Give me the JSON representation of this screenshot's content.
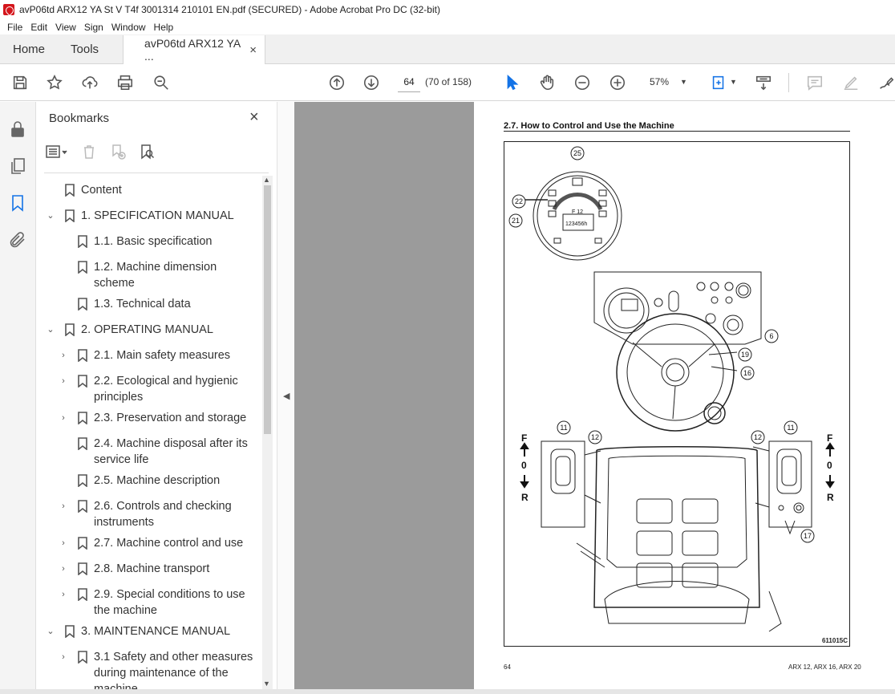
{
  "window": {
    "title": "avP06td ARX12 YA St V T4f 3001314 210101 EN.pdf (SECURED) - Adobe Acrobat Pro DC (32-bit)"
  },
  "menu": [
    "File",
    "Edit",
    "View",
    "Sign",
    "Window",
    "Help"
  ],
  "tabs": {
    "home": "Home",
    "tools": "Tools",
    "document": "avP06td ARX12 YA ...",
    "close": "×"
  },
  "toolbar": {
    "page_number": "64",
    "page_of": "(70 of 158)",
    "zoom": "57%",
    "icons": [
      "save-icon",
      "star-icon",
      "upload-icon",
      "print-icon",
      "zoom-search-icon",
      "page-up-icon",
      "page-down-icon",
      "select-cursor-icon",
      "hand-icon",
      "zoom-out-icon",
      "zoom-in-icon",
      "fit-page-icon",
      "scroll-mode-icon",
      "comment-icon",
      "highlight-icon",
      "sign-icon"
    ]
  },
  "bookmarks": {
    "title": "Bookmarks",
    "close": "×",
    "items": [
      {
        "label": "Content",
        "level": 0,
        "chevron": ""
      },
      {
        "label": "1. SPECIFICATION MANUAL",
        "level": 0,
        "chevron": "⌄"
      },
      {
        "label": "1.1. Basic specification",
        "level": 1,
        "chevron": ""
      },
      {
        "label": "1.2. Machine dimension",
        "label2": "scheme",
        "level": 1,
        "chevron": ""
      },
      {
        "label": "1.3. Technical data",
        "level": 1,
        "chevron": ""
      },
      {
        "label": "2. OPERATING MANUAL",
        "level": 0,
        "chevron": "⌄"
      },
      {
        "label": "2.1. Main safety measures",
        "level": 1,
        "chevron": "›"
      },
      {
        "label": "2.2. Ecological and hygienic",
        "label2": "principles",
        "level": 1,
        "chevron": "›"
      },
      {
        "label": "2.3. Preservation and storage",
        "level": 1,
        "chevron": "›"
      },
      {
        "label": "2.4. Machine disposal after its",
        "label2": "service life",
        "level": 1,
        "chevron": ""
      },
      {
        "label": "2.5. Machine description",
        "level": 1,
        "chevron": ""
      },
      {
        "label": "2.6. Controls and checking",
        "label2": "instruments",
        "level": 1,
        "chevron": "›"
      },
      {
        "label": "2.7. Machine control and use",
        "level": 1,
        "chevron": "›"
      },
      {
        "label": "2.8. Machine transport",
        "level": 1,
        "chevron": "›"
      },
      {
        "label": "2.9. Special conditions to use",
        "label2": "the machine",
        "level": 1,
        "chevron": "›"
      },
      {
        "label": "3. MAINTENANCE MANUAL",
        "level": 0,
        "chevron": "⌄"
      },
      {
        "label": "3.1 Safety and other measures",
        "label2": "during maintenance of the",
        "label3": "machine",
        "level": 1,
        "chevron": "›"
      }
    ]
  },
  "page": {
    "heading": "2.7.    How to Control and Use the Machine",
    "figure_code": "611015C",
    "page_number": "64",
    "footer": "ARX 12, ARX 16, ARX 20",
    "callouts": [
      "25",
      "22",
      "21",
      "6",
      "19",
      "16",
      "11",
      "12",
      "12",
      "11",
      "17"
    ],
    "display": "F 12",
    "odometer": "123456h",
    "direction": [
      "F",
      "0",
      "R"
    ]
  }
}
